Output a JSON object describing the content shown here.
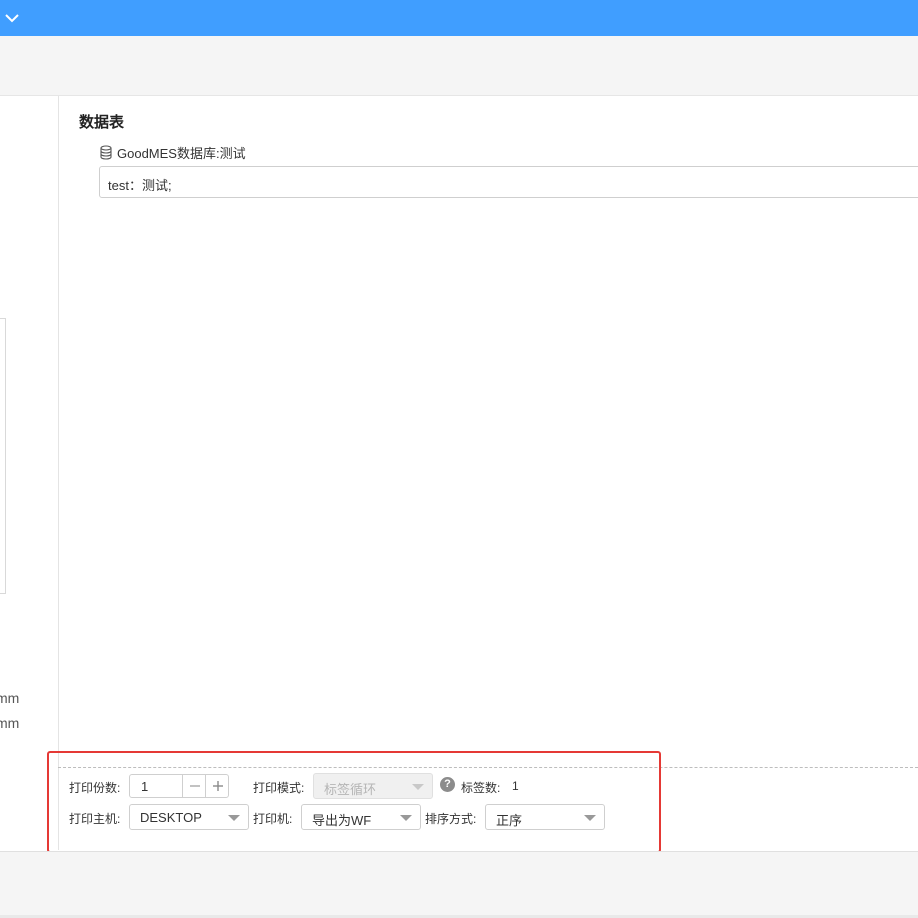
{
  "header": {
    "dropdown_icon": "chevron-down-icon",
    "accent_color": "#409eff"
  },
  "left_panel": {
    "unit_1": "mm",
    "unit_2": "mm"
  },
  "data_table": {
    "section_title": "数据表",
    "database_icon": "database-icon",
    "database_label": "GoodMES数据库:测试",
    "table_value": "test：测试;"
  },
  "print_settings": {
    "copies_label": "打印份数:",
    "copies_value": "1",
    "minus_icon": "minus-icon",
    "plus_icon": "plus-icon",
    "mode_label": "打印模式:",
    "mode_value": "标签循环",
    "help_icon": "question-icon",
    "label_count_label": "标签数:",
    "label_count_value": "1",
    "host_label": "打印主机:",
    "host_value": "DESKTOP",
    "printer_label": "打印机:",
    "printer_value": "导出为WF",
    "sort_label": "排序方式:",
    "sort_value": "正序",
    "highlight_color": "#e53935"
  }
}
